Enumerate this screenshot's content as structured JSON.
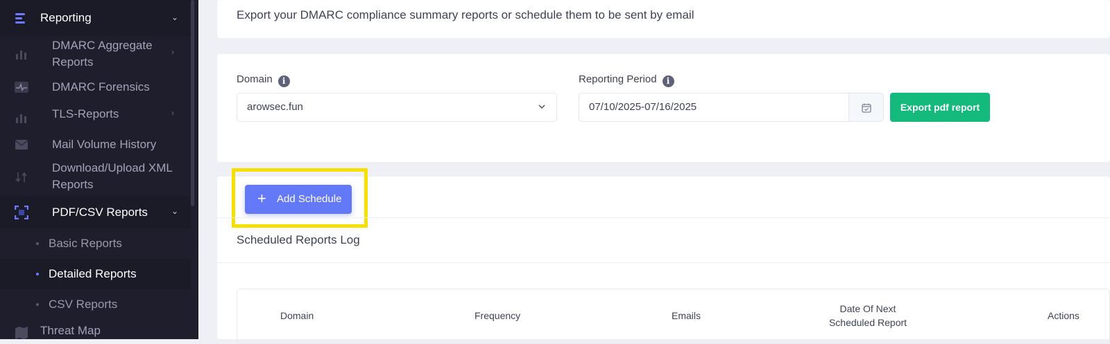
{
  "sidebar": {
    "section": {
      "label": "Reporting"
    },
    "items": [
      {
        "label_line1": "DMARC Aggregate",
        "label_line2": "Reports"
      },
      {
        "label": "DMARC Forensics"
      },
      {
        "label": "TLS-Reports"
      },
      {
        "label": "Mail Volume History"
      },
      {
        "label_line1": "Download/Upload XML",
        "label_line2": "Reports"
      },
      {
        "label": "PDF/CSV Reports"
      }
    ],
    "subitems": [
      {
        "label": "Basic Reports"
      },
      {
        "label": "Detailed Reports"
      },
      {
        "label": "CSV Reports"
      }
    ],
    "next_section": {
      "label": "Threat Map"
    }
  },
  "intro": {
    "text": "Export your DMARC compliance summary reports or schedule them to be sent by email"
  },
  "filters": {
    "domain_label": "Domain",
    "domain_value": "arowsec.fun",
    "period_label": "Reporting Period",
    "period_value": "07/10/2025-07/16/2025",
    "export_label": "Export pdf report"
  },
  "schedule": {
    "add_label": "Add Schedule",
    "log_title": "Scheduled Reports Log",
    "columns": {
      "domain": "Domain",
      "frequency": "Frequency",
      "emails": "Emails",
      "next_line1": "Date Of Next",
      "next_line2": "Scheduled Report",
      "actions": "Actions"
    }
  },
  "colors": {
    "sidebar_bg": "#1e1e2d",
    "accent": "#6479f7",
    "export_green": "#14b97c",
    "highlight_yellow": "#f7e000"
  }
}
